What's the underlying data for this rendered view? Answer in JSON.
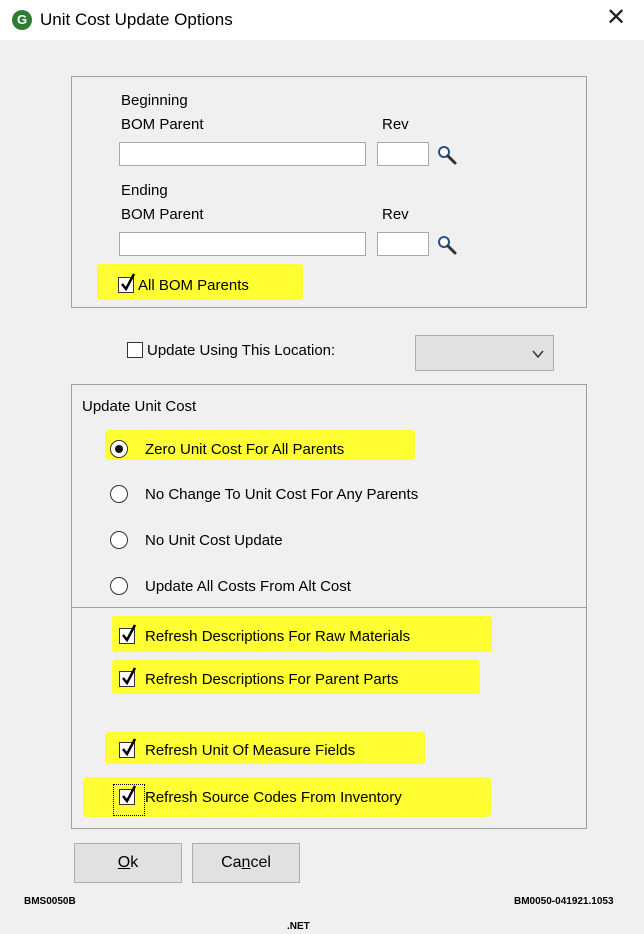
{
  "window": {
    "title": "Unit Cost Update Options",
    "close_glyph": "✕",
    "app_icon_letter": "G"
  },
  "bom_range": {
    "beginning_label_1": "Beginning",
    "beginning_label_2": "BOM Parent",
    "beginning_rev_label": "Rev",
    "beginning_parent_value": "",
    "beginning_rev_value": "",
    "ending_label_1": "Ending",
    "ending_label_2": "BOM Parent",
    "ending_rev_label": "Rev",
    "ending_parent_value": "",
    "ending_rev_value": "",
    "all_parents_label": "All BOM Parents",
    "all_parents_checked": true
  },
  "location": {
    "label": "Update Using This Location:",
    "checked": false,
    "selected_value": ""
  },
  "update_unit_cost": {
    "group_label": "Update Unit Cost",
    "options": [
      {
        "label": "Zero Unit Cost For All Parents",
        "selected": true
      },
      {
        "label": "No Change To Unit Cost For Any Parents",
        "selected": false
      },
      {
        "label": "No Unit Cost Update",
        "selected": false
      },
      {
        "label": "Update All Costs From Alt Cost",
        "selected": false
      }
    ]
  },
  "refresh": {
    "options": [
      {
        "label": "Refresh Descriptions For Raw Materials",
        "checked": true
      },
      {
        "label": "Refresh Descriptions For Parent Parts",
        "checked": true
      },
      {
        "label": "Refresh Unit Of Measure Fields",
        "checked": true
      },
      {
        "label": "Refresh Source Codes From Inventory",
        "checked": true
      }
    ]
  },
  "buttons": {
    "ok_prefix": "O",
    "ok_rest": "k",
    "cancel_prefix": "Ca",
    "cancel_mnemonic": "n",
    "cancel_rest": "cel"
  },
  "footer": {
    "left_code": "BMS0050B",
    "right_code": "BM0050-041921.1053",
    "bottom": ".NET"
  },
  "colors": {
    "highlight": "#ffff33",
    "app_icon": "#2e7d32",
    "background": "#f0f0f0"
  }
}
